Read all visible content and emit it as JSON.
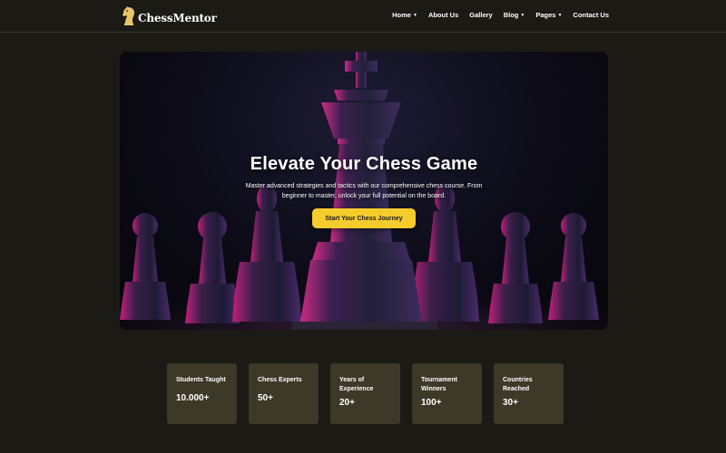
{
  "brand": {
    "name": "ChessMentor",
    "icon": "knight-icon",
    "accent": "#f4cc2c"
  },
  "nav": {
    "items": [
      {
        "label": "Home",
        "dropdown": true
      },
      {
        "label": "About Us",
        "dropdown": false
      },
      {
        "label": "Gallery",
        "dropdown": false
      },
      {
        "label": "Blog",
        "dropdown": true
      },
      {
        "label": "Pages",
        "dropdown": true
      },
      {
        "label": "Contact Us",
        "dropdown": false
      }
    ]
  },
  "hero": {
    "title": "Elevate Your Chess Game",
    "subtitle": "Master advanced strategies and tactics with our comprehensive chess course. From beginner to master, unlock your full potential on the board.",
    "cta_label": "Start Your Chess Journey"
  },
  "stats": [
    {
      "label": "Students Taught",
      "value": "10.000+"
    },
    {
      "label": "Chess Experts",
      "value": "50+"
    },
    {
      "label": "Years of Experience",
      "value": "20+"
    },
    {
      "label": "Tournament Winners",
      "value": "100+"
    },
    {
      "label": "Countries Reached",
      "value": "30+"
    }
  ]
}
